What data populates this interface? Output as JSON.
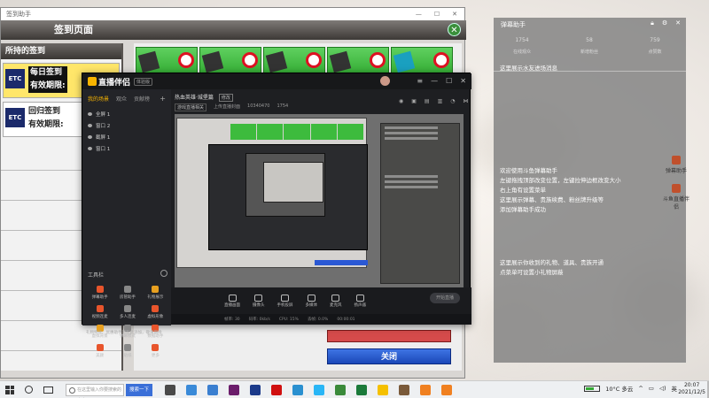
{
  "signin_window": {
    "title": "签到助手",
    "header": "签到页面",
    "left_header": "所持的签到",
    "items": [
      {
        "logo": "ETC",
        "line1": "每日签到",
        "line2": "有效期限:",
        "active": true
      },
      {
        "logo": "ETC",
        "line1": "回归签到",
        "line2": "有效期限:",
        "active": false
      }
    ],
    "close_label": "关闭"
  },
  "stream_app": {
    "app_name": "直播伴侣",
    "badge": "体验版",
    "tabs": [
      "我的场景",
      "观众",
      "贡献榜"
    ],
    "scenes": [
      "全屏 1",
      "窗口 2",
      "截屏 1",
      "窗口 1"
    ],
    "stream_title": "热血英雄·城堡篇",
    "stream_tag": "修改",
    "category": "游戏直播相关",
    "upload_text": "上传直播封面",
    "room_id": "10340470",
    "viewers": "1754",
    "tools_header": "工具栏",
    "tools": [
      {
        "label": "弹幕助手",
        "icon": "danmaku-icon"
      },
      {
        "label": "房管助手",
        "icon": "admin-icon"
      },
      {
        "label": "礼物展示",
        "icon": "gift-icon"
      },
      {
        "label": "视频连麦",
        "icon": "video-icon"
      },
      {
        "label": "多人连麦",
        "icon": "multi-icon"
      },
      {
        "label": "虚拟形象",
        "icon": "avatar-icon"
      },
      {
        "label": "虚拟背景",
        "icon": "background-icon"
      },
      {
        "label": "弹幕模式",
        "icon": "mode-icon"
      },
      {
        "label": "数据助手",
        "icon": "data-icon"
      },
      {
        "label": "美颜",
        "icon": "beauty-icon"
      },
      {
        "label": "贴纸",
        "icon": "sticker-icon"
      },
      {
        "label": "更多",
        "icon": "more-icon"
      }
    ],
    "notice": "礼物特效、优惠助手可在此添加，敬请期待",
    "bottom_tools": [
      "直播画面",
      "摄像头",
      "手机投屏",
      "多媒体",
      "麦克风",
      "扬声器"
    ],
    "live_button": "开始直播",
    "status_items": [
      "帧率: 30",
      "码率: 0kb/s",
      "CPU: 15%",
      "丢帧: 0.0%",
      "00:00:01"
    ]
  },
  "assistant_window": {
    "title": "弹幕助手",
    "stats": [
      {
        "value": "1754",
        "label": "在线观众"
      },
      {
        "value": "58",
        "label": "新增粉丝"
      },
      {
        "value": "759",
        "label": "点赞数"
      }
    ],
    "msg1": "这里展示水友进场消息",
    "msg2_lines": [
      "欢迎使用斗鱼弹幕助手",
      "左键拖拽顶部改变位置，左键拉伸边框改变大小",
      "右上角有设置菜单",
      "这里展示弹幕、贵族续费、粉丝牌升级等",
      "添加弹幕助手成功"
    ],
    "msg3_lines": [
      "这里展示你收到的礼物、道具、贵族开通",
      "点菜单可设置小礼物屏蔽"
    ]
  },
  "desktop_icons": [
    "弹幕助手",
    "斗鱼直播伴侣"
  ],
  "taskbar": {
    "search_placeholder": "在这里输入你要搜索的内容",
    "search_button": "搜索一下",
    "weather": "10°C 多云",
    "ime": "英",
    "time": "20:07",
    "date": "2021/12/5",
    "app_colors": [
      "#4a4a4a",
      "#3a8ad8",
      "#3a7fd0",
      "#6b1d6b",
      "#1b3a8a",
      "#d01010",
      "#2a90d0",
      "#29b6f6",
      "#3a8a3a",
      "#1b7a3a",
      "#f5c000",
      "#7a5a3a",
      "#f08020",
      "#f08020"
    ]
  }
}
